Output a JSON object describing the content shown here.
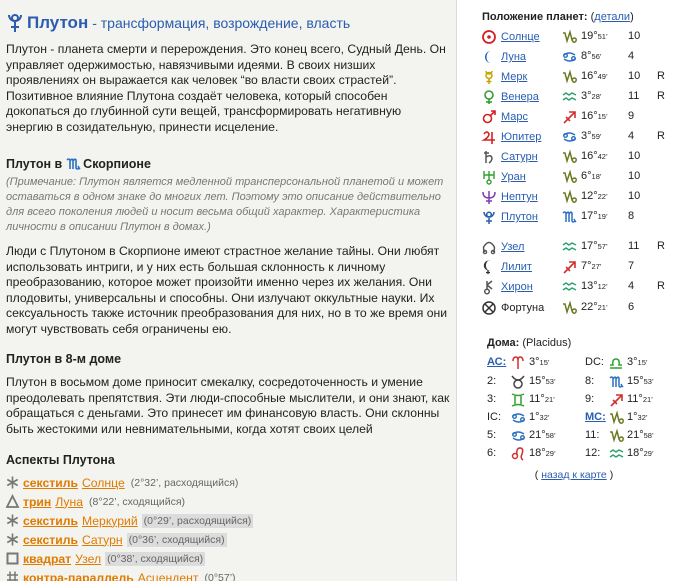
{
  "main": {
    "title": "Плутон",
    "subtitle": "- трансформация, возрождение, власть",
    "intro": "Плутон - планета смерти и перерождения. Это конец всего, Судный День. Он управляет одержимостью, навязчивыми идеями. В своих низших проявлениях он выражается как человек “во власти своих страстей”. Позитивное влияние Плутона создаёт человека, который способен докопаться до глубинной сути вещей, трансформировать негативную энергию в созидательную, принести исцеление.",
    "sign_heading": "Плутон в",
    "sign_name": "Скорпионе",
    "note": "(Примечание: Плутон является медленной трансперсональной планетой и может оставаться в одном знаке до многих лет. Поэтому это описание действительно для всего поколения людей и носит весьма общий характер. Характеристика личности в описании Плутон в домах.)",
    "sign_text": "Люди с Плутоном в Скорпионе имеют страстное желание тайны. Они любят использовать интриги, и у них есть большая склонность к личному преобразованию, которое может произойти именно через их желания. Они плодовиты, универсальны и способны. Они излучают оккультные науки. Их сексуальность также источник преобразования для них, но в то же время они могут чувствовать себя ограничены ею.",
    "house_heading": "Плутон в 8-м доме",
    "house_text": "Плутон в восьмом доме приносит смекалку, сосредоточенность и умение преодолевать препятствия. Эти люди-способные мыслители, и они знают, как обращаться с деньгами. Это принесет им финансовую власть. Они склонны быть жестокими или невнимательными, когда хотят своих целей",
    "aspects_heading": "Аспекты Плутона",
    "aspects": [
      {
        "icon": "sextile-icon",
        "type": "секстиль",
        "object": "Солнце",
        "extra": "(2°32’, расходящийся)",
        "hl": false
      },
      {
        "icon": "trine-icon",
        "type": "трин",
        "object": "Луна",
        "extra": "(8°22’, сходящийся)",
        "hl": false
      },
      {
        "icon": "sextile-icon",
        "type": "секстиль",
        "object": "Меркурий",
        "extra": "(0°29’, расходящийся)",
        "hl": true
      },
      {
        "icon": "sextile-icon",
        "type": "секстиль",
        "object": "Сатурн",
        "extra": "(0°36’, сходящийся)",
        "hl": true
      },
      {
        "icon": "square-icon",
        "type": "квадрат",
        "object": "Узел",
        "extra": "(0°38’, сходящийся)",
        "hl": true
      },
      {
        "icon": "contraparallel-icon",
        "type": "контра-параллель",
        "object": "Асцендент",
        "extra": "(0°57’)",
        "hl": false
      }
    ]
  },
  "sidebar": {
    "title": "Положение планет:",
    "details_link": "детали",
    "planets": [
      {
        "glyph": "sun",
        "name": "Солнце",
        "sign": "capricorn",
        "deg": "19°",
        "min": "51’",
        "house": "10",
        "retro": "",
        "color": "#d32020",
        "zcolor": "#6a7a20",
        "link": true
      },
      {
        "glyph": "moon",
        "name": "Луна",
        "sign": "cancer",
        "deg": "8°",
        "min": "56’",
        "house": "4",
        "retro": "",
        "color": "#2060c0",
        "zcolor": "#2a70c0",
        "link": true
      },
      {
        "glyph": "mercury",
        "name": "Мерк",
        "sign": "capricorn",
        "deg": "16°",
        "min": "49’",
        "house": "10",
        "retro": "R",
        "color": "#c8a000",
        "zcolor": "#6a7a20",
        "link": true
      },
      {
        "glyph": "venus",
        "name": "Венера",
        "sign": "aquarius",
        "deg": "3°",
        "min": "28’",
        "house": "11",
        "retro": "R",
        "color": "#30a030",
        "zcolor": "#30a070",
        "link": true
      },
      {
        "glyph": "mars",
        "name": "Марс",
        "sign": "sagittarius",
        "deg": "16°",
        "min": "15’",
        "house": "9",
        "retro": "",
        "color": "#d32020",
        "zcolor": "#d03030",
        "link": true
      },
      {
        "glyph": "jupiter",
        "name": "Юпитер",
        "sign": "cancer",
        "deg": "3°",
        "min": "59’",
        "house": "4",
        "retro": "R",
        "color": "#d32020",
        "zcolor": "#2a70c0",
        "link": true
      },
      {
        "glyph": "saturn",
        "name": "Сатурн",
        "sign": "capricorn",
        "deg": "16°",
        "min": "42’",
        "house": "10",
        "retro": "",
        "color": "#555555",
        "zcolor": "#6a7a20",
        "link": true
      },
      {
        "glyph": "uranus",
        "name": "Уран",
        "sign": "capricorn",
        "deg": "6°",
        "min": "18’",
        "house": "10",
        "retro": "",
        "color": "#30a030",
        "zcolor": "#6a7a20",
        "link": true
      },
      {
        "glyph": "neptune",
        "name": "Нептун",
        "sign": "capricorn",
        "deg": "12°",
        "min": "22’",
        "house": "10",
        "retro": "",
        "color": "#7a40b0",
        "zcolor": "#6a7a20",
        "link": true
      },
      {
        "glyph": "pluto",
        "name": "Плутон",
        "sign": "scorpio",
        "deg": "17°",
        "min": "19’",
        "house": "8",
        "retro": "",
        "color": "#2a5db0",
        "zcolor": "#2a70c0",
        "link": true
      },
      {
        "glyph": "node",
        "name": "Узел",
        "sign": "aquarius",
        "deg": "17°",
        "min": "57’",
        "house": "11",
        "retro": "R",
        "color": "#555555",
        "zcolor": "#30a070",
        "link": true
      },
      {
        "glyph": "lilith",
        "name": "Лилит",
        "sign": "sagittarius",
        "deg": "7°",
        "min": "27’",
        "house": "7",
        "retro": "",
        "color": "#333333",
        "zcolor": "#d03030",
        "link": true
      },
      {
        "glyph": "chiron",
        "name": "Хирон",
        "sign": "aquarius",
        "deg": "13°",
        "min": "12’",
        "house": "4",
        "retro": "R",
        "color": "#555555",
        "zcolor": "#30a070",
        "link": true
      },
      {
        "glyph": "fortune",
        "name": "Фортуна",
        "sign": "capricorn",
        "deg": "22°",
        "min": "21’",
        "house": "6",
        "retro": "",
        "color": "#333333",
        "zcolor": "#6a7a20",
        "link": false
      }
    ],
    "houses_title": "Дома:",
    "houses_system": "(Placidus)",
    "houses": [
      {
        "label": "АС:",
        "sign": "aries",
        "deg": "3°",
        "min": "15’",
        "link": true,
        "zcolor": "#d03030"
      },
      {
        "label": "DC:",
        "sign": "libra",
        "deg": "3°",
        "min": "15’",
        "link": false,
        "zcolor": "#30a030"
      },
      {
        "label": "2:",
        "sign": "taurus",
        "deg": "15°",
        "min": "53’",
        "link": false,
        "zcolor": "#444444"
      },
      {
        "label": "8:",
        "sign": "scorpio",
        "deg": "15°",
        "min": "53’",
        "link": false,
        "zcolor": "#2a70c0"
      },
      {
        "label": "3:",
        "sign": "gemini",
        "deg": "11°",
        "min": "21’",
        "link": false,
        "zcolor": "#30a030"
      },
      {
        "label": "9:",
        "sign": "sagittarius",
        "deg": "11°",
        "min": "21’",
        "link": false,
        "zcolor": "#d03030"
      },
      {
        "label": "IC:",
        "sign": "cancer",
        "deg": "1°",
        "min": "32’",
        "link": false,
        "zcolor": "#2a70c0"
      },
      {
        "label": "МС:",
        "sign": "capricorn",
        "deg": "1°",
        "min": "32’",
        "link": true,
        "zcolor": "#6a7a20"
      },
      {
        "label": "5:",
        "sign": "cancer",
        "deg": "21°",
        "min": "58’",
        "link": false,
        "zcolor": "#2a70c0"
      },
      {
        "label": "11:",
        "sign": "capricorn",
        "deg": "21°",
        "min": "58’",
        "link": false,
        "zcolor": "#6a7a20"
      },
      {
        "label": "6:",
        "sign": "leo",
        "deg": "18°",
        "min": "29’",
        "link": false,
        "zcolor": "#d03030"
      },
      {
        "label": "12:",
        "sign": "aquarius",
        "deg": "18°",
        "min": "29’",
        "link": false,
        "zcolor": "#30a070"
      }
    ],
    "back_link": "назад к карте",
    "back_open": "(",
    "back_close": ")"
  }
}
